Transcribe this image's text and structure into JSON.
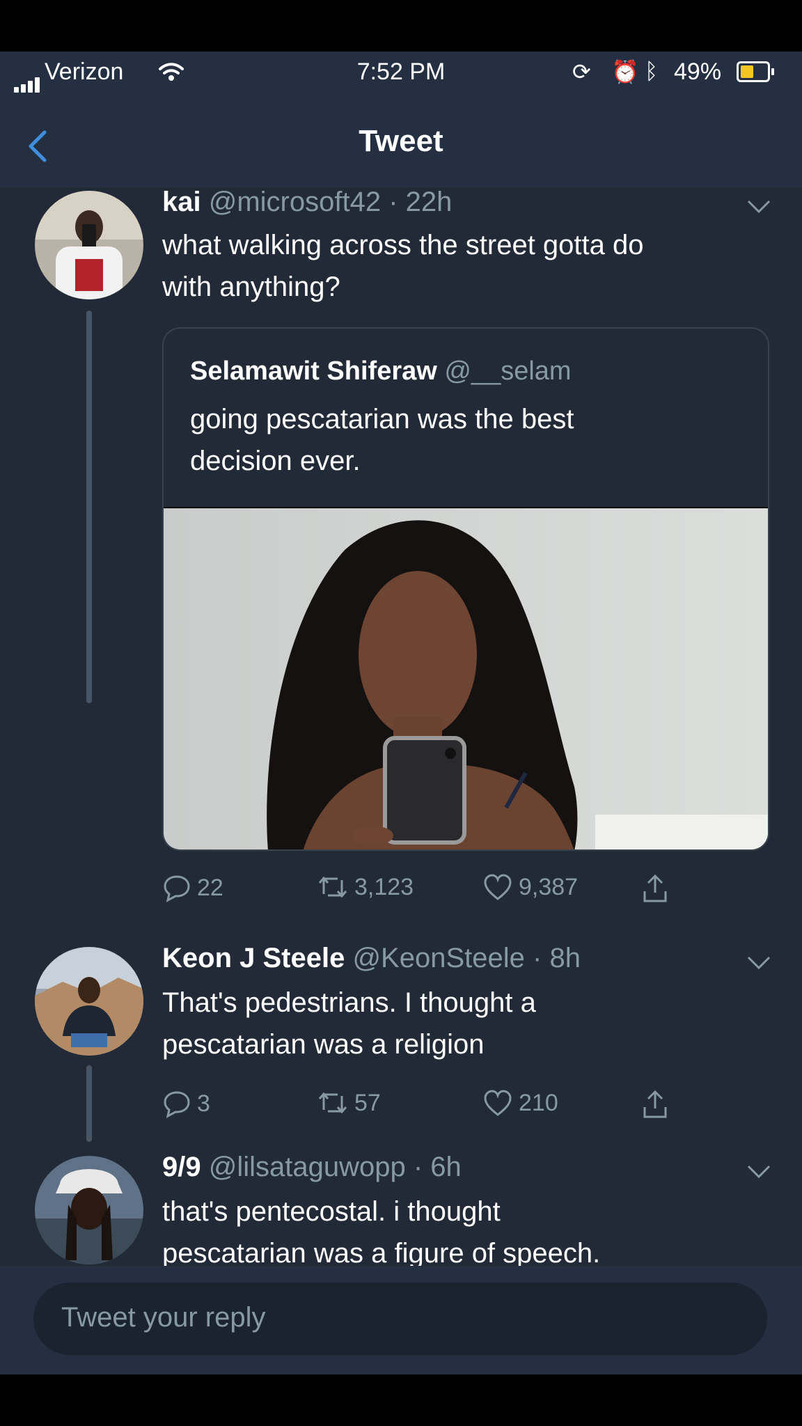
{
  "status_bar": {
    "carrier": "Verizon",
    "time": "7:52 PM",
    "battery": "49%",
    "battery_level": 0.49
  },
  "header": {
    "title": "Tweet"
  },
  "tweets": [
    {
      "name": "kai",
      "handle": "@microsoft42",
      "time": "· 22h",
      "lines": [
        "what walking across the street gotta do",
        "with anything?"
      ],
      "quote": {
        "name": "Selamawit Shiferaw",
        "handle": "@__selam",
        "lines": [
          "going pescatarian was the best",
          "decision ever."
        ]
      },
      "replies": "22",
      "retweets": "3,123",
      "likes": "9,387"
    },
    {
      "name": "Keon J Steele",
      "handle": "@KeonSteele",
      "time": "· 8h",
      "lines": [
        "That's pedestrians. I thought a",
        "pescatarian was a religion"
      ],
      "replies": "3",
      "retweets": "57",
      "likes": "210"
    },
    {
      "name": "9/9",
      "handle": "@lilsataguwopp",
      "time": "· 6h",
      "lines": [
        "that's pentecostal. i thought",
        "pescatarian was a figure of speech."
      ]
    }
  ],
  "reply_box": {
    "placeholder": "Tweet your reply"
  },
  "icons": [
    "back-chevron-icon",
    "wifi-icon",
    "lock-rotation-icon",
    "alarm-icon",
    "bluetooth-icon",
    "chevron-down-icon",
    "reply-icon",
    "retweet-icon",
    "like-icon",
    "share-icon"
  ],
  "colors": {
    "background": "#222a37",
    "header": "#243042",
    "accent": "#3f8fdd",
    "secondary_text": "#8899a6",
    "battery": "#f3c623"
  }
}
